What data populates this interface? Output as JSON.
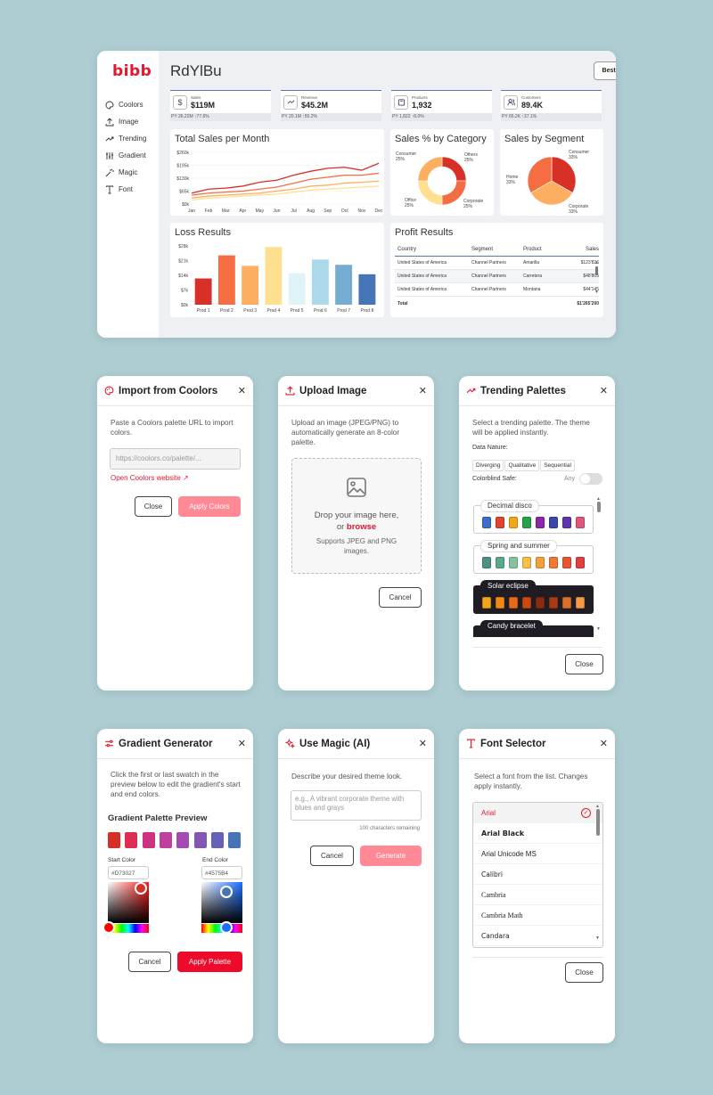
{
  "dashboard": {
    "logo": "bibb",
    "title": "RdYlBu",
    "template_button": "Best PBI Template",
    "nav": [
      {
        "label": "Coolors",
        "icon": "palette-icon"
      },
      {
        "label": "Image",
        "icon": "upload-icon"
      },
      {
        "label": "Trending",
        "icon": "trending-icon"
      },
      {
        "label": "Gradient",
        "icon": "sliders-icon"
      },
      {
        "label": "Magic",
        "icon": "magic-icon"
      },
      {
        "label": "Font",
        "icon": "font-icon"
      }
    ],
    "kpis": [
      {
        "label": "Sales",
        "value": "$119M",
        "prev": "PY 26.22M ↑77.6%",
        "icon": "dollar-icon"
      },
      {
        "label": "Revenue",
        "value": "$45.2M",
        "prev": "PY 20.1M ↑55.2%",
        "icon": "trend-icon"
      },
      {
        "label": "Products",
        "value": "1,932",
        "prev": "PY 1,822 ↑6.0%",
        "icon": "box-icon"
      },
      {
        "label": "Customers",
        "value": "89.4K",
        "prev": "PY 65.2K ↑37.1%",
        "icon": "users-icon"
      }
    ],
    "cards": {
      "sales_month": "Total Sales per Month",
      "sales_category": "Sales % by Category",
      "sales_segment": "Sales by Segment",
      "loss": "Loss Results",
      "profit": "Profit Results"
    },
    "profit_table": {
      "headers": [
        "Country",
        "Segment",
        "Product",
        "Sales"
      ],
      "rows": [
        [
          "United States of America",
          "Channel Partners",
          "Amarilla",
          "$123'826"
        ],
        [
          "United States of America",
          "Channel Partners",
          "Carretera",
          "$48'805"
        ],
        [
          "United States of America",
          "Channel Partners",
          "Montana",
          "$44'145"
        ]
      ],
      "total": [
        "Total",
        "",
        "",
        "$1'265'200"
      ]
    }
  },
  "chart_data": [
    {
      "type": "line",
      "title": "Total Sales per Month",
      "x": [
        "Jan",
        "Feb",
        "Mar",
        "Apr",
        "May",
        "Jun",
        "Jul",
        "Aug",
        "Sep",
        "Oct",
        "Nov",
        "Dec"
      ],
      "y_ticks": [
        "$0k",
        "$65k",
        "$130k",
        "$195k",
        "$260k"
      ],
      "ylim": [
        0,
        260
      ],
      "series": [
        {
          "values": [
            55,
            75,
            80,
            90,
            110,
            120,
            145,
            165,
            180,
            185,
            170,
            205
          ],
          "color": "#d73027"
        },
        {
          "values": [
            45,
            55,
            60,
            65,
            75,
            85,
            105,
            125,
            135,
            145,
            145,
            155
          ],
          "color": "#f46d43"
        },
        {
          "values": [
            30,
            40,
            45,
            50,
            55,
            65,
            75,
            90,
            95,
            105,
            110,
            115
          ],
          "color": "#fdae61"
        },
        {
          "values": [
            20,
            30,
            35,
            40,
            45,
            50,
            60,
            70,
            75,
            80,
            85,
            90
          ],
          "color": "#fee090"
        }
      ]
    },
    {
      "type": "pie",
      "title": "Sales % by Category",
      "labels": [
        "Consumer\n25%",
        "Others\n25%",
        "Corporate\n25%",
        "Office\n25%"
      ],
      "values": [
        25,
        25,
        25,
        25
      ],
      "colors": [
        "#d73027",
        "#f46d43",
        "#fee090",
        "#fdae61"
      ],
      "donut": true
    },
    {
      "type": "pie",
      "title": "Sales by Segment",
      "labels": [
        "Consumer\n33%",
        "Corporate\n33%",
        "Home\n33%"
      ],
      "values": [
        33.3,
        33.3,
        33.3
      ],
      "colors": [
        "#d73027",
        "#fdae61",
        "#f46d43"
      ]
    },
    {
      "type": "bar",
      "title": "Loss Results",
      "categories": [
        "Prod 1",
        "Prod 2",
        "Prod 3",
        "Prod 4",
        "Prod 5",
        "Prod 6",
        "Prod 7",
        "Prod 8"
      ],
      "values": [
        12.5,
        23.5,
        18.5,
        27.5,
        15,
        21.5,
        19,
        14.5
      ],
      "y_ticks": [
        "$0k",
        "$7k",
        "$14k",
        "$21k",
        "$28k"
      ],
      "ylim": [
        0,
        28
      ],
      "colors": [
        "#d73027",
        "#f46d43",
        "#fdae61",
        "#fee090",
        "#e0f3f8",
        "#abd9e9",
        "#74add1",
        "#4575b4"
      ]
    }
  ],
  "dialogs": {
    "coolors": {
      "title": "Import from Coolors",
      "desc": "Paste a Coolors palette URL to import colors.",
      "placeholder": "https://coolors.co/palette/...",
      "link": "Open Coolors website ↗",
      "close": "Close",
      "apply": "Apply Colors"
    },
    "upload": {
      "title": "Upload Image",
      "desc": "Upload an image (JPEG/PNG) to automatically generate an 8-color palette.",
      "drop": "Drop your image here,",
      "or": "or",
      "browse": "browse",
      "supports": "Supports JPEG and PNG images.",
      "cancel": "Cancel"
    },
    "trending": {
      "title": "Trending Palettes",
      "desc": "Select a trending palette. The theme will be applied instantly.",
      "nature_label": "Data Nature:",
      "natures": [
        "Diverging",
        "Qualitative",
        "Sequential"
      ],
      "colorblind_label": "Colorblind Safe:",
      "colorblind_value": "Any",
      "palettes": [
        {
          "name": "Decimal disco",
          "dark": false,
          "colors": [
            "#3b6ecc",
            "#e0452c",
            "#f2a516",
            "#22a34a",
            "#8e24aa",
            "#3949ab",
            "#5e35b1",
            "#e0567a"
          ]
        },
        {
          "name": "Spring and summer",
          "dark": false,
          "colors": [
            "#4e8f86",
            "#5aa88e",
            "#88c0a0",
            "#f7c04a",
            "#f5a03a",
            "#ef7a36",
            "#e9552f",
            "#e04040"
          ]
        },
        {
          "name": "Solar eclipse",
          "dark": true,
          "colors": [
            "#f2a516",
            "#f08a16",
            "#e86a16",
            "#c84a12",
            "#8a2a10",
            "#a83a16",
            "#d8702a",
            "#f29a4a"
          ]
        },
        {
          "name": "Candy bracelet",
          "dark": true,
          "colors": [
            "#a6c8ee",
            "#f5e2a0",
            "#f5c4a0",
            "#c8b4e8",
            "#f2a8c8",
            "#b8d8f2",
            "#e8c8f2",
            "#a8b8e8"
          ]
        }
      ],
      "close": "Close"
    },
    "gradient": {
      "title": "Gradient Generator",
      "desc": "Click the first or last swatch in the preview below to edit the gradient's start and end colors.",
      "preview_label": "Gradient Palette Preview",
      "colors": [
        "#d73027",
        "#de2d55",
        "#cc3280",
        "#c03e9e",
        "#a34bb0",
        "#8456b4",
        "#6662b7",
        "#4575b4"
      ],
      "start_label": "Start Color",
      "start_value": "#D73027",
      "end_label": "End Color",
      "end_value": "#4575B4",
      "cancel": "Cancel",
      "apply": "Apply Palette"
    },
    "magic": {
      "title": "Use Magic (AI)",
      "desc": "Describe your desired theme look.",
      "placeholder": "e.g., A vibrant corporate theme with blues and grays",
      "remaining": "100 characters remaining",
      "cancel": "Cancel",
      "generate": "Generate"
    },
    "font": {
      "title": "Font Selector",
      "desc": "Select a font from the list. Changes apply instantly.",
      "fonts": [
        "Arial",
        "Arial Black",
        "Arial Unicode MS",
        "Calibri",
        "Cambria",
        "Cambria Math",
        "Candara"
      ],
      "close": "Close"
    }
  }
}
